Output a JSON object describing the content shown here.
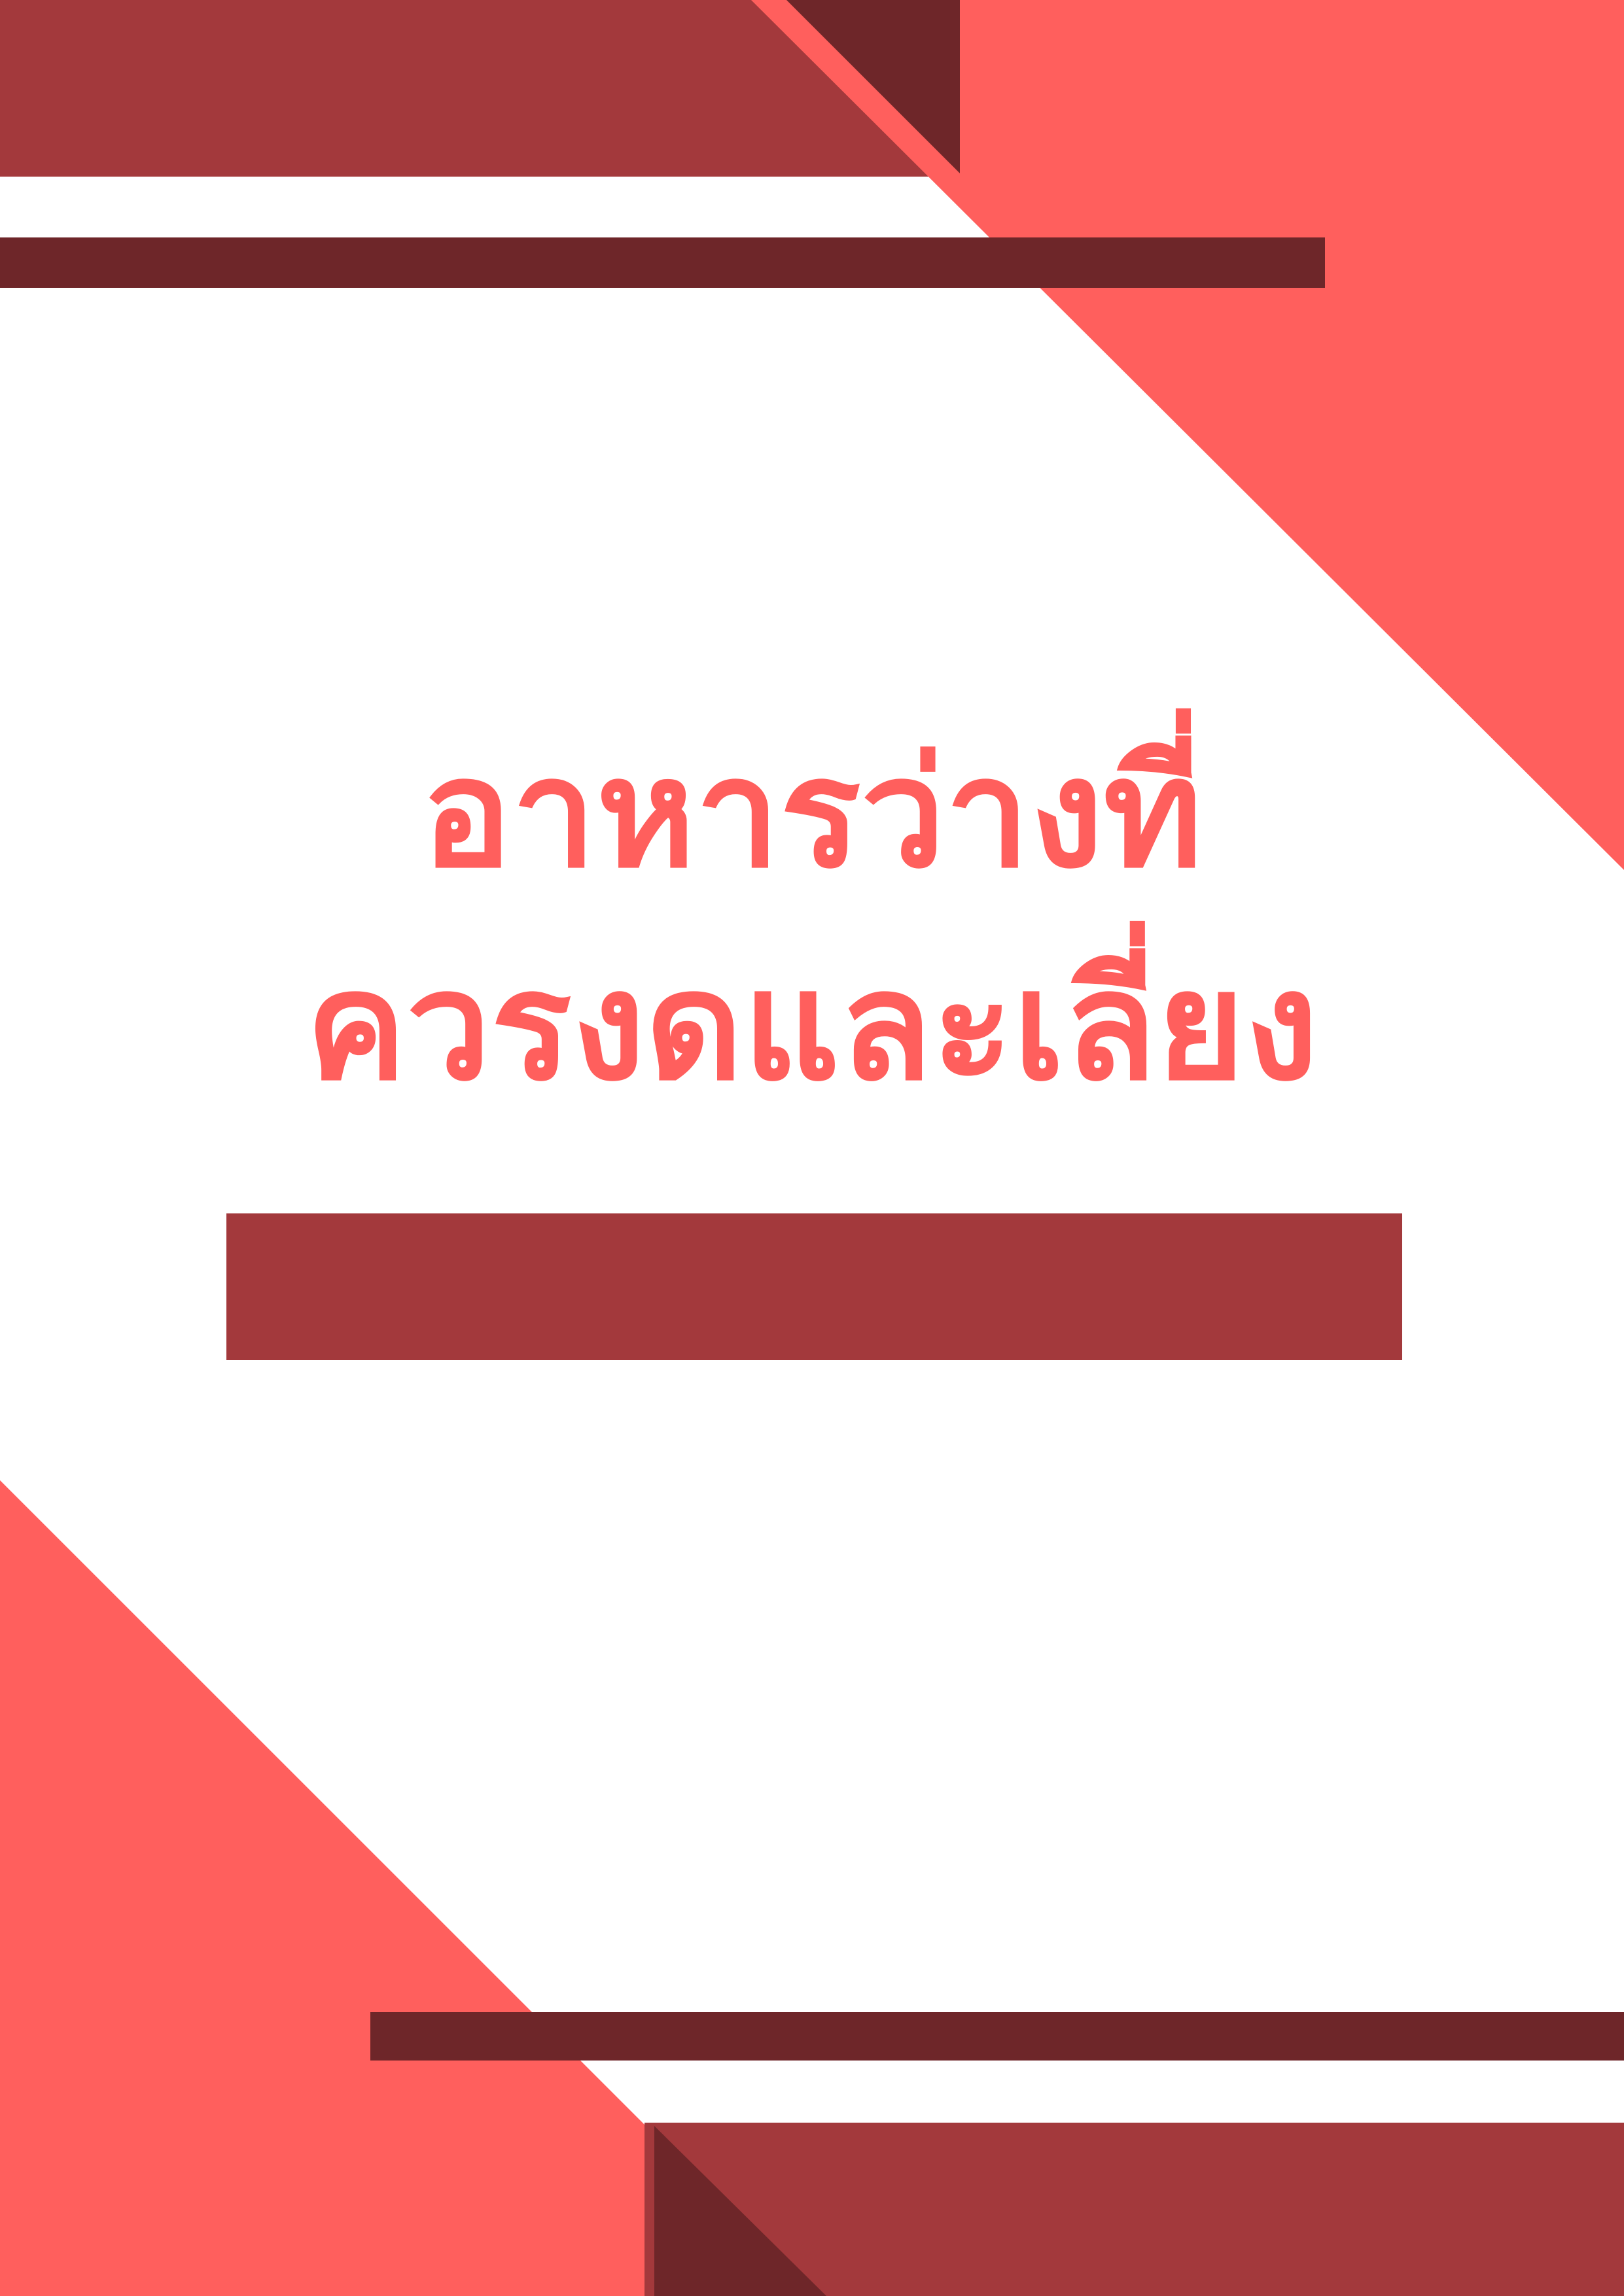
{
  "document": {
    "title_lines": [
      "อาหารว่างที่",
      "ควรงดและเลี่ยง"
    ]
  },
  "colors": {
    "coral": "#ff5f5d",
    "brick_red": "#a3393c",
    "dark_maroon": "#6e2629",
    "background": "#ffffff",
    "title_text": "#ff5f5d"
  }
}
